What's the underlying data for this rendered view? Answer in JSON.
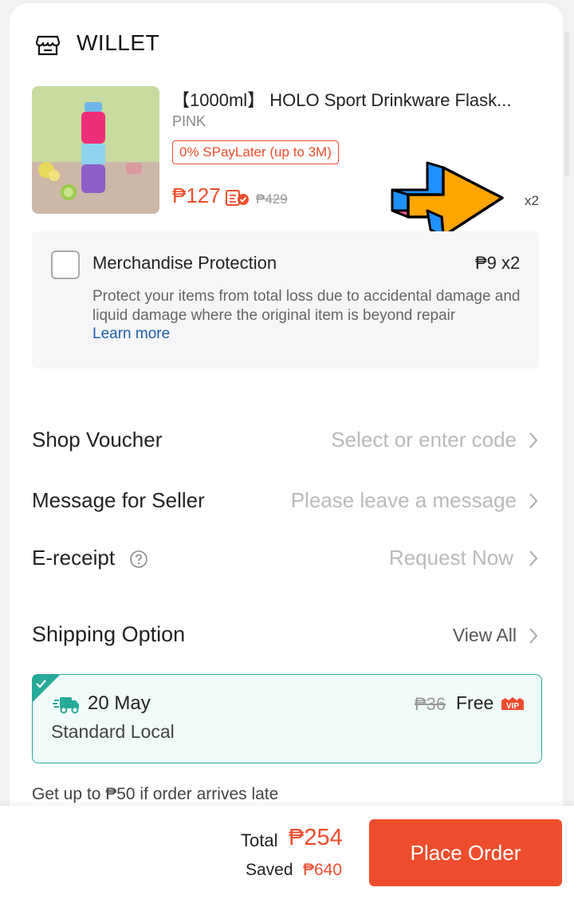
{
  "shop": {
    "name": "WILLET",
    "icon": "store-icon"
  },
  "product": {
    "title": "【1000ml】 HOLO Sport Drinkware Flask...",
    "variant": "PINK",
    "promo_badge": "0% SPayLater (up to 3M)",
    "price": "₱127",
    "original_price": "₱429",
    "quantity": "x2",
    "coin_icon": "coins-cashback-icon"
  },
  "protection": {
    "title": "Merchandise Protection",
    "price": "₱9 x2",
    "description": "Protect your items from total loss due to accidental damage and liquid damage where the original item is beyond repair",
    "link": "Learn more",
    "checked": false
  },
  "rows": {
    "voucher": {
      "label": "Shop Voucher",
      "value": "Select or enter code"
    },
    "message": {
      "label": "Message for Seller",
      "placeholder": "Please leave a message"
    },
    "receipt": {
      "label": "E-receipt",
      "value": "Request Now"
    }
  },
  "shipping": {
    "title": "Shipping Option",
    "view_all": "View All",
    "date": "20 May",
    "type": "Standard Local",
    "old_fee": "₱36",
    "fee": "Free",
    "vip_badge": "VIP",
    "late_guarantee": "Get up to ₱50 if order arrives late"
  },
  "footer": {
    "total_label": "Total",
    "total_value": "₱254",
    "saved_label": "Saved",
    "saved_value": "₱640",
    "place_order": "Place Order"
  },
  "colors": {
    "accent": "#ee4d2d",
    "teal": "#26aa99",
    "link": "#1b5fa8",
    "arrow_orange": "#ffa500",
    "arrow_blue": "#1e90ff",
    "arrow_pink": "#ff5c9d"
  }
}
